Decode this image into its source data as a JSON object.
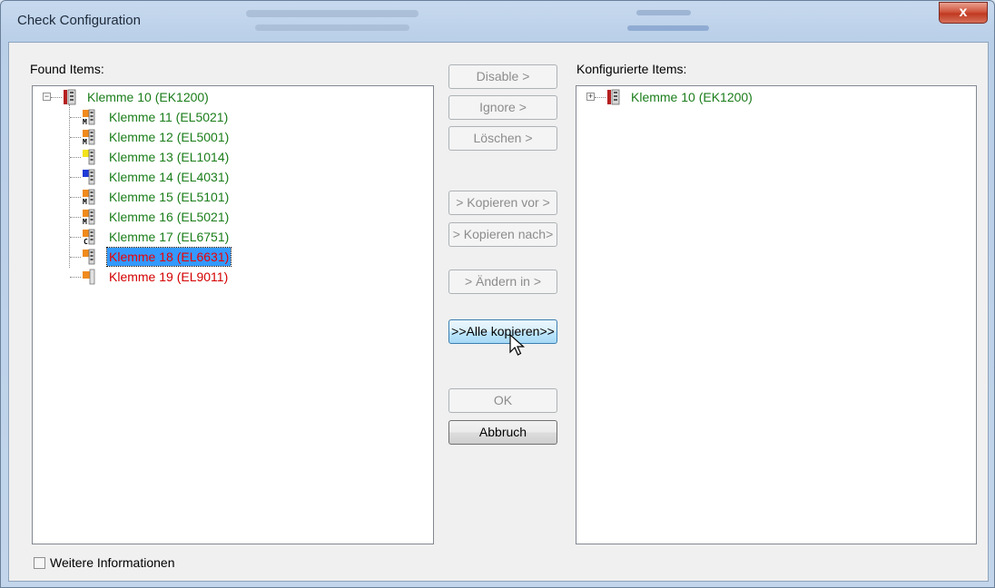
{
  "window": {
    "title": "Check Configuration",
    "close_label": "x"
  },
  "found": {
    "label": "Found Items:",
    "root": {
      "label": "Klemme 10 (EK1200)",
      "expander": "−"
    },
    "items": [
      {
        "label": "Klemme 11 (EL5021)",
        "status": "ok",
        "icon": "orange-M-terminal-icon"
      },
      {
        "label": "Klemme 12 (EL5001)",
        "status": "ok",
        "icon": "orange-M-terminal-icon"
      },
      {
        "label": "Klemme 13 (EL1014)",
        "status": "ok",
        "icon": "yellow-terminal-icon"
      },
      {
        "label": "Klemme 14 (EL4031)",
        "status": "ok",
        "icon": "blue-terminal-icon"
      },
      {
        "label": "Klemme 15 (EL5101)",
        "status": "ok",
        "icon": "orange-M-terminal-icon"
      },
      {
        "label": "Klemme 16 (EL5021)",
        "status": "ok",
        "icon": "orange-M-terminal-icon"
      },
      {
        "label": "Klemme 17 (EL6751)",
        "status": "ok",
        "icon": "orange-C-terminal-icon"
      },
      {
        "label": "Klemme 18 (EL6631)",
        "status": "selected",
        "icon": "orange-terminal-icon"
      },
      {
        "label": "Klemme 19 (EL9011)",
        "status": "error",
        "icon": "end-terminal-icon"
      }
    ]
  },
  "configured": {
    "label": "Konfigurierte Items:",
    "root": {
      "label": "Klemme 10 (EK1200)",
      "expander": "+"
    }
  },
  "buttons": {
    "disable": "Disable >",
    "ignore": "Ignore >",
    "delete": "Löschen >",
    "copy_before": "> Kopieren vor >",
    "copy_after": "> Kopieren nach>",
    "change_to": "> Ändern in >",
    "copy_all": ">>Alle kopieren>>",
    "ok": "OK",
    "cancel": "Abbruch"
  },
  "footer": {
    "more_info_label": "Weitere Informationen",
    "more_info_checked": false
  },
  "colors": {
    "ok_text": "#1a7d1a",
    "error_text": "#d40000",
    "selection": "#3399ff"
  }
}
